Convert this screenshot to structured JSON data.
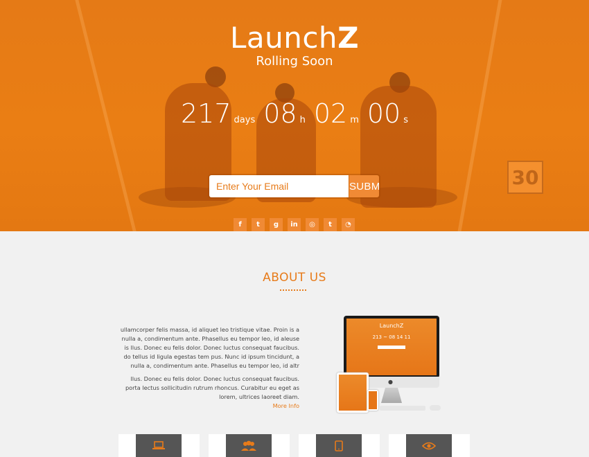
{
  "hero": {
    "brand_prefix": "Launch",
    "brand_suffix": "Z",
    "tagline": "Rolling Soon",
    "countdown": [
      {
        "value": "217",
        "unit": "days"
      },
      {
        "value": "08",
        "unit": "h"
      },
      {
        "value": "02",
        "unit": "m"
      },
      {
        "value": "00",
        "unit": "s"
      }
    ],
    "email_placeholder": "Enter Your Email",
    "submit_label": "SUBMIT",
    "field_marker": "30",
    "socials": [
      {
        "glyph": "f",
        "icon": "facebook-icon"
      },
      {
        "glyph": "t",
        "icon": "twitter-icon"
      },
      {
        "glyph": "g",
        "icon": "google-plus-icon"
      },
      {
        "glyph": "in",
        "icon": "linkedin-icon"
      },
      {
        "glyph": "◎",
        "icon": "instagram-icon"
      },
      {
        "glyph": "t",
        "icon": "tumblr-icon"
      },
      {
        "glyph": "◔",
        "icon": "rss-icon"
      }
    ]
  },
  "about": {
    "title": "ABOUT US",
    "paragraph1": "ullamcorper felis massa, id aliquet leo tristique vitae. Proin is a nulla a, condimentum ante. Phasellus eu tempor leo, id aleuse is llus. Donec eu felis dolor. Donec luctus consequat faucibus. do tellus id ligula egestas tem pus. Nunc id ipsum tincidunt, a nulla a, condimentum ante. Phasellus eu tempor leo, id altr",
    "paragraph2": "llus. Donec eu felis dolor. Donec luctus consequat faucibus. porta lectus sollicitudin rutrum rhoncus. Curabitur eu eget as lorem, ultrices laoreet diam.",
    "more_info": "More Info",
    "mockup": {
      "brand": "LaunchZ",
      "countdown": "213 ~ 08 14 11"
    }
  },
  "features": [
    {
      "icon": "laptop-icon"
    },
    {
      "icon": "users-icon"
    },
    {
      "icon": "tablet-icon"
    },
    {
      "icon": "eye-icon"
    }
  ],
  "colors": {
    "accent": "#e77b1a",
    "hero_bg": "#ea7e14",
    "card_icon_bg": "#555555",
    "page_bg": "#f1f1f1"
  }
}
